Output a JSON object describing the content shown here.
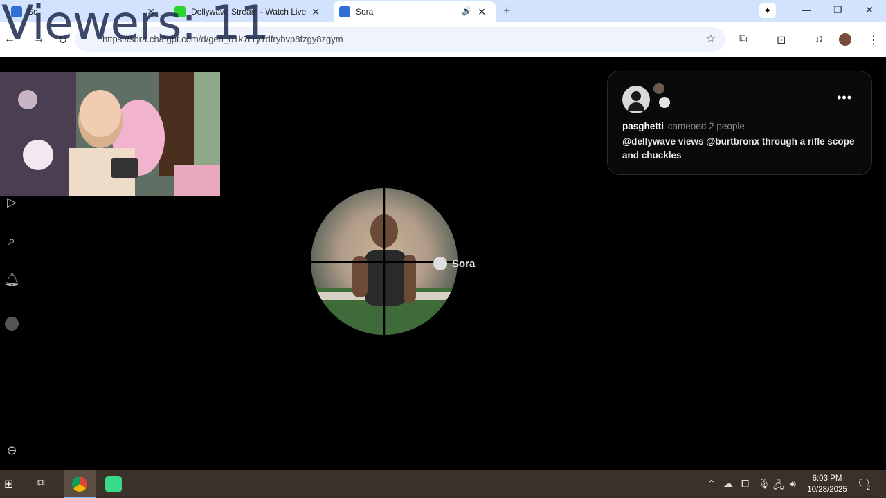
{
  "overlay": {
    "viewers_label": "Viewers: 11"
  },
  "browser": {
    "tabs": [
      {
        "title": "So",
        "icon": "sora-favicon",
        "active": false
      },
      {
        "title": "Dellywave Stream - Watch Live",
        "icon": "kick-favicon",
        "active": false
      },
      {
        "title": "Sora",
        "icon": "sora-favicon",
        "active": true,
        "audio": true
      }
    ],
    "url": "https://sora.chatgpt.com/d/gen_01k7r1y1dfrybvp8fzgy8zgym"
  },
  "post": {
    "username": "pasghetti",
    "action": "cameoed 2 people",
    "caption": "@dellywave views @burtbronx through a rifle scope and chuckles",
    "watermark": "Sora"
  },
  "taskbar": {
    "time": "6:03 PM",
    "date": "10/28/2025",
    "notifications": "2"
  },
  "colors": {
    "tabstrip": "#d3e3fd",
    "taskbar": "#3a3129",
    "card_border": "#2b2b2b"
  }
}
